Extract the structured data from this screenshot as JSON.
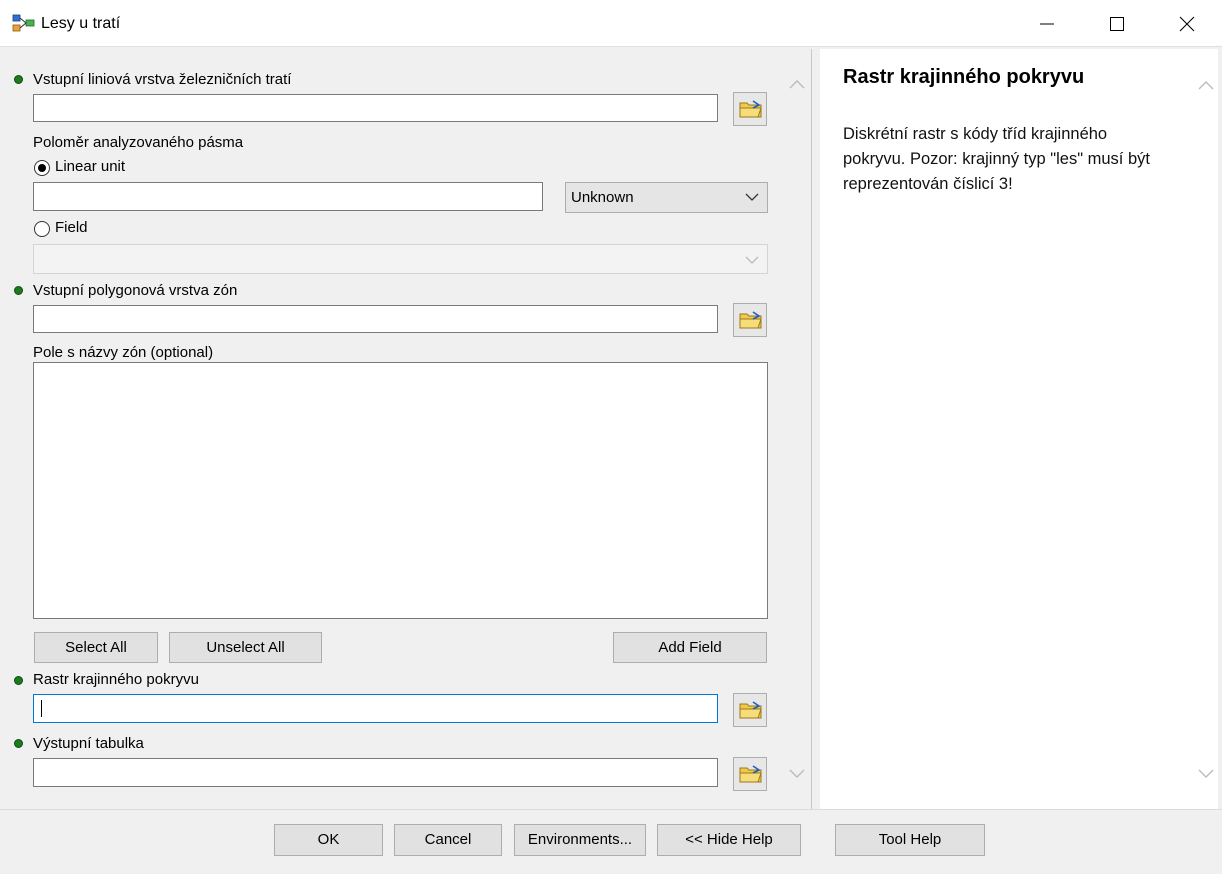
{
  "window": {
    "title": "Lesy u tratí",
    "minimize_glyph": "—",
    "maximize_glyph": "□",
    "close_glyph": "✕"
  },
  "form": {
    "railway_layer_label": "Vstupní liniová vrstva železničních tratí",
    "railway_layer_value": "",
    "buffer_radius_label": "Poloměr analyzovaného pásma",
    "linear_unit_label": "Linear unit",
    "linear_unit_value": "",
    "unit_selected": "Unknown",
    "field_label": "Field",
    "field_selected": "",
    "zone_layer_label": "Vstupní polygonová vrstva zón",
    "zone_layer_value": "",
    "zone_names_field_label": "Pole s názvy zón (optional)",
    "select_all_label": "Select All",
    "unselect_all_label": "Unselect All",
    "add_field_label": "Add Field",
    "landcover_raster_label": "Rastr krajinného pokryvu",
    "landcover_raster_value": "",
    "output_table_label": "Výstupní tabulka",
    "output_table_value": ""
  },
  "help": {
    "title": "Rastr krajinného pokryvu",
    "text": "Diskrétní rastr s kódy tříd krajinného pokryvu. Pozor: krajinný typ \"les\" musí být reprezentován číslicí 3!"
  },
  "footer": {
    "ok_label": "OK",
    "cancel_label": "Cancel",
    "environments_label": "Environments...",
    "hide_help_label": "<< Hide Help",
    "tool_help_label": "Tool Help"
  },
  "icons": {
    "app": "model-tool-icon",
    "browse": "open-folder-icon",
    "required": "required-parameter-dot",
    "dropdown": "chevron-down-icon",
    "scroll_up": "chevron-up-icon",
    "scroll_down": "chevron-down-icon"
  },
  "colors": {
    "required_dot": "#1f7a1f",
    "folder": "#f2c94c",
    "active_input_border": "#0078d7"
  }
}
